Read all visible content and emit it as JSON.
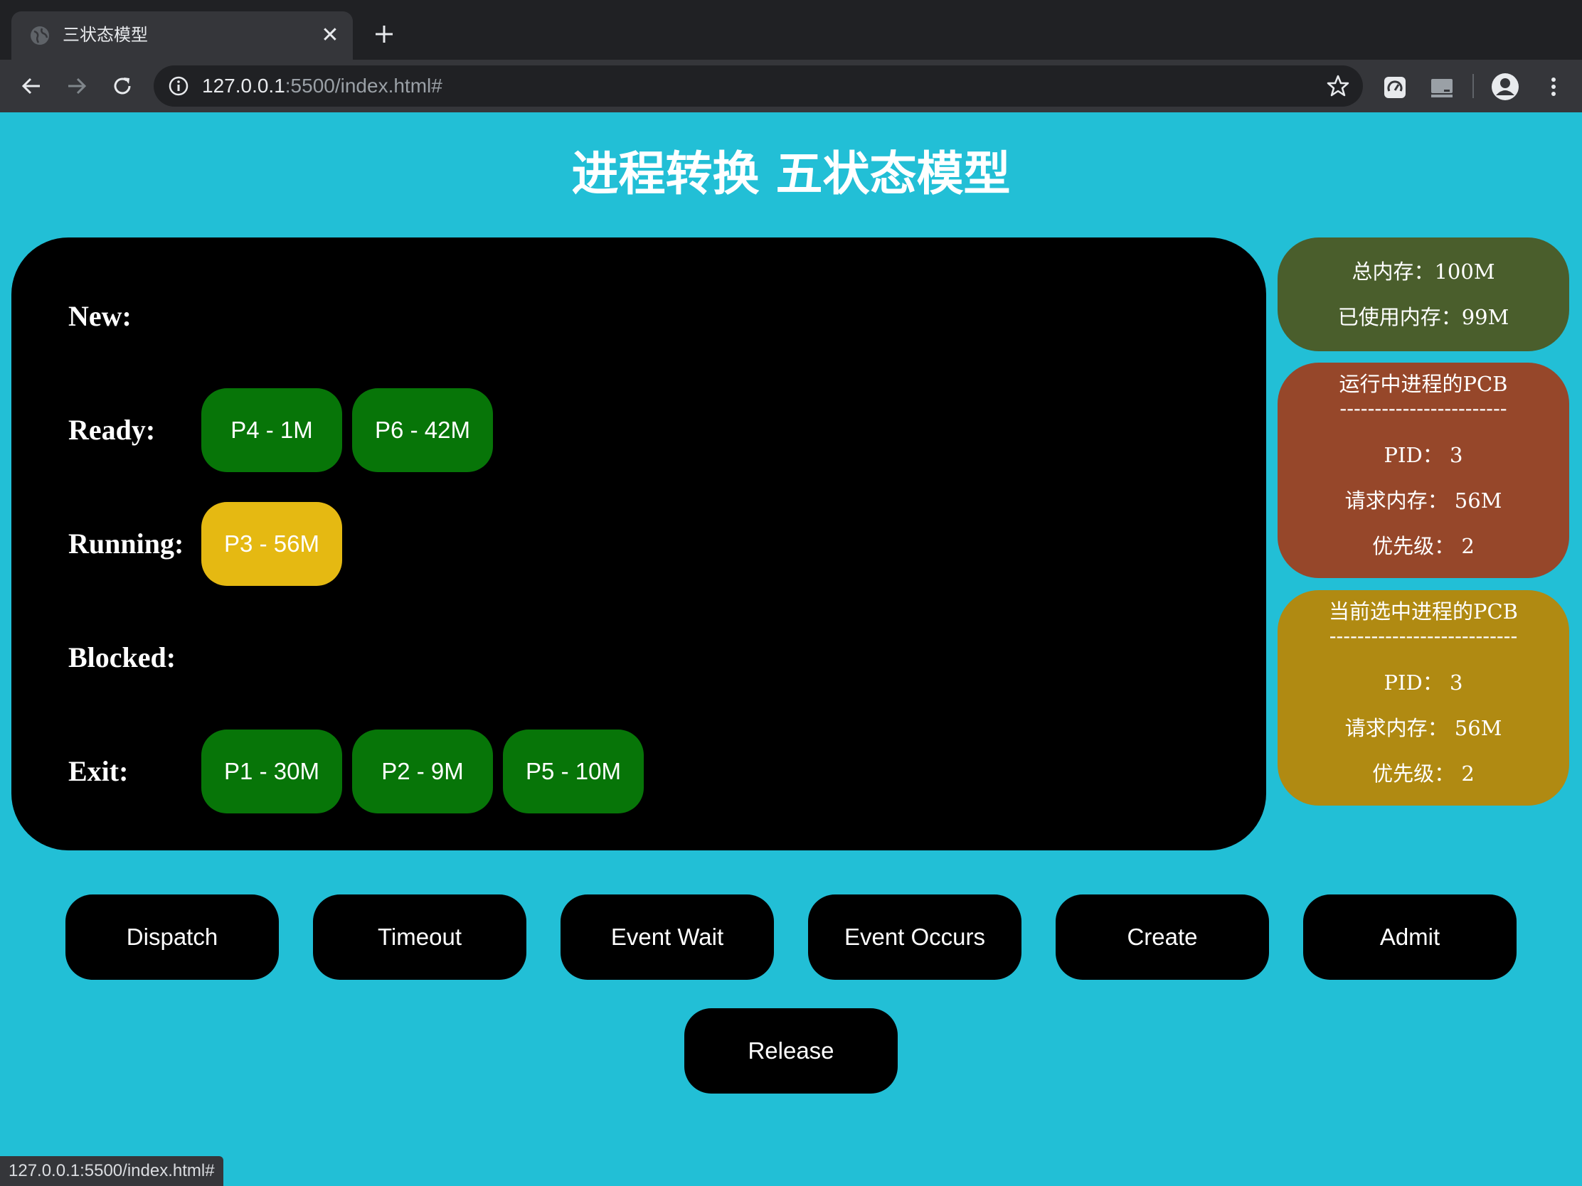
{
  "browser": {
    "tab_title": "三状态模型",
    "url_host": "127.0.0.1",
    "url_rest": ":5500/index.html#",
    "status_url": "127.0.0.1:5500/index.html#"
  },
  "page": {
    "title": "进程转换 五状态模型"
  },
  "states": {
    "new": {
      "label": "New:",
      "processes": []
    },
    "ready": {
      "label": "Ready:",
      "processes": [
        "P4 - 1M",
        "P6 - 42M"
      ]
    },
    "running": {
      "label": "Running:",
      "processes": [
        "P3 - 56M"
      ]
    },
    "blocked": {
      "label": "Blocked:",
      "processes": []
    },
    "exit": {
      "label": "Exit:",
      "processes": [
        "P1 - 30M",
        "P2 - 9M",
        "P5 - 10M"
      ]
    }
  },
  "memory": {
    "total": "总内存：100M",
    "used": "已使用内存：99M"
  },
  "running_pcb": {
    "title": "运行中进程的PCB",
    "divider": "------------------------",
    "pid": "PID： 3",
    "mem": "请求内存： 56M",
    "priority": "优先级： 2"
  },
  "selected_pcb": {
    "title": "当前选中进程的PCB",
    "divider": "---------------------------",
    "pid": "PID： 3",
    "mem": "请求内存： 56M",
    "priority": "优先级： 2"
  },
  "actions": [
    "Dispatch",
    "Timeout",
    "Event Wait",
    "Event Occurs",
    "Create",
    "Admit",
    "Release"
  ],
  "colors": {
    "background": "#22bfd6",
    "process_normal": "#077508",
    "process_running": "#e5b912",
    "memory_card": "#4a5e2c",
    "running_card": "#96472a",
    "selected_card": "#b08a12"
  }
}
